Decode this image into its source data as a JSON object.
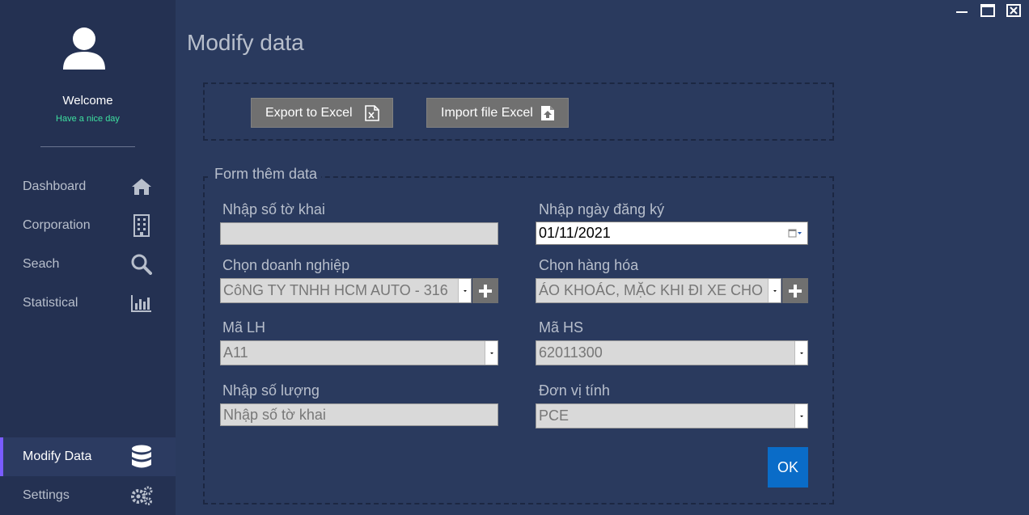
{
  "sidebar": {
    "welcome": "Welcome",
    "tagline": "Have a nice day",
    "items": [
      {
        "label": "Dashboard",
        "icon": "home-icon"
      },
      {
        "label": "Corporation",
        "icon": "building-icon"
      },
      {
        "label": "Seach",
        "icon": "search-icon"
      },
      {
        "label": "Statistical",
        "icon": "bar-chart-icon"
      },
      {
        "label": "Modify Data",
        "icon": "database-icon",
        "active": true
      },
      {
        "label": "Settings",
        "icon": "gears-icon"
      }
    ]
  },
  "window_controls": [
    "minimize-icon",
    "maximize-icon",
    "close-icon"
  ],
  "main": {
    "title": "Modify data",
    "export_label": "Export to Excel",
    "import_label": "Import file Excel",
    "form": {
      "legend": "Form thêm data",
      "declaration_no_label": "Nhập số tờ khai",
      "declaration_no_value": "",
      "reg_date_label": "Nhập ngày đăng ký",
      "reg_date_value": "01/11/2021",
      "company_label": "Chọn doanh nghiệp",
      "company_value": "CôNG TY TNHH HCM AUTO - 316",
      "goods_label": "Chọn hàng hóa",
      "goods_value": "ÁO KHOÁC, MẶC KHI ĐI XE CHO",
      "ma_lh_label": "Mã LH",
      "ma_lh_value": "A11",
      "ma_hs_label": "Mã HS",
      "ma_hs_value": "62011300",
      "quantity_label": "Nhập số lượng",
      "quantity_value": "Nhập số tờ khai",
      "unit_label": "Đơn vị tính",
      "unit_value": "PCE",
      "ok_label": "OK"
    }
  },
  "colors": {
    "background": "#2a3a5e",
    "sidebar": "#243152",
    "accent_active": "#7a5cff",
    "tagline": "#3ee0a0",
    "ok_button": "#0a6cc8",
    "button": "#707070"
  }
}
